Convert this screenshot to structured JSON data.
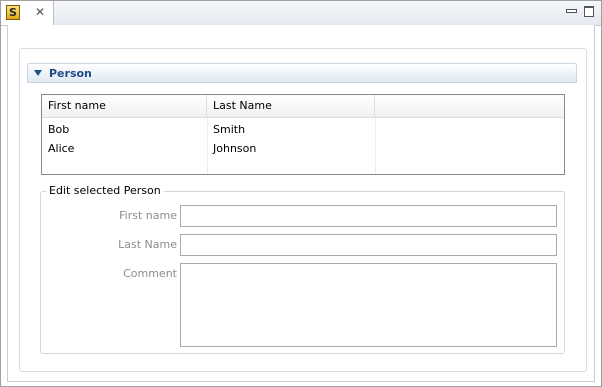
{
  "tab": {
    "icon_letter": "S",
    "close_glyph": "✕"
  },
  "window_controls": {
    "minimize_icon": "minimize-icon",
    "maximize_icon": "maximize-icon"
  },
  "section": {
    "title": "Person",
    "expanded": true
  },
  "table": {
    "columns": [
      "First name",
      "Last Name",
      ""
    ],
    "rows": [
      [
        "Bob",
        "Smith",
        ""
      ],
      [
        "Alice",
        "Johnson",
        ""
      ]
    ]
  },
  "edit_group": {
    "title": "Edit selected Person",
    "fields": {
      "first_name": {
        "label": "First name",
        "value": ""
      },
      "last_name": {
        "label": "Last Name",
        "value": ""
      },
      "comment": {
        "label": "Comment",
        "value": ""
      }
    }
  },
  "colors": {
    "section_title": "#1f4d87",
    "disabled_label": "#8c8c8c",
    "tab_background": "#e4e9f0"
  }
}
